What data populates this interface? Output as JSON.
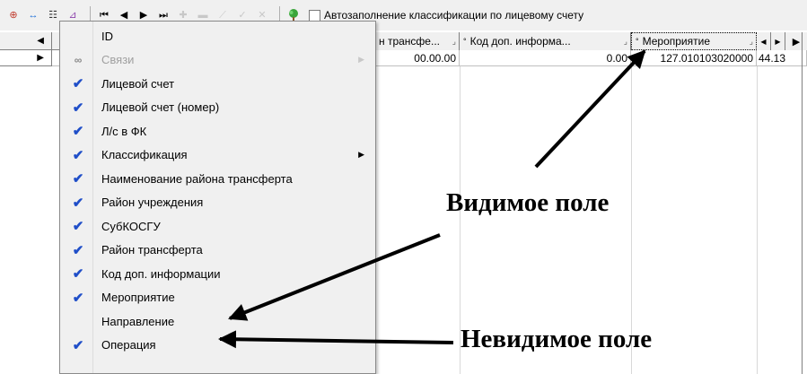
{
  "toolbar": {
    "buttons": [
      {
        "name": "add-record-icon",
        "glyph": "⊕",
        "color": "#c0392b"
      },
      {
        "name": "swap-icon",
        "glyph": "↔",
        "color": "#1e6fd9"
      },
      {
        "name": "list-icon",
        "glyph": "☷",
        "color": "#333"
      },
      {
        "name": "filter-icon",
        "glyph": "⊿",
        "color": "#8e44ad"
      }
    ],
    "nav": [
      {
        "name": "first-record-icon",
        "glyph": "⏮",
        "enabled": true
      },
      {
        "name": "prev-record-icon",
        "glyph": "◀",
        "enabled": true
      },
      {
        "name": "next-record-icon",
        "glyph": "▶",
        "enabled": true
      },
      {
        "name": "last-record-icon",
        "glyph": "⏭",
        "enabled": true
      },
      {
        "name": "insert-record-icon",
        "glyph": "✚",
        "enabled": false
      },
      {
        "name": "delete-record-icon",
        "glyph": "▬",
        "enabled": false
      },
      {
        "name": "edit-record-icon",
        "glyph": "⟋",
        "enabled": false
      },
      {
        "name": "post-record-icon",
        "glyph": "✓",
        "enabled": false
      },
      {
        "name": "cancel-record-icon",
        "glyph": "✕",
        "enabled": false
      }
    ],
    "tree_icon": "tree-icon",
    "autofill_label": "Автозаполнение классификации по лицевому счету"
  },
  "grid": {
    "headers": [
      {
        "label": "н трансфе...",
        "sort": "⌟"
      },
      {
        "label": "Код доп. информа...",
        "sort": "⌟",
        "marker": "°"
      },
      {
        "label": "Мероприятие",
        "sort": "⌟",
        "marker": "°",
        "selected": true
      }
    ],
    "row": [
      "00.00.00",
      "0.00",
      "127.010103020000",
      "44.13"
    ]
  },
  "menu": {
    "items": [
      {
        "label": "ID",
        "checked": false,
        "enabled": true,
        "submenu": false
      },
      {
        "label": "Связи",
        "checked": false,
        "enabled": false,
        "submenu": true,
        "icon": "link-icon"
      },
      {
        "label": "Лицевой счет",
        "checked": true,
        "enabled": true,
        "submenu": false
      },
      {
        "label": "Лицевой счет (номер)",
        "checked": true,
        "enabled": true,
        "submenu": false
      },
      {
        "label": "Л/с в ФК",
        "checked": true,
        "enabled": true,
        "submenu": false
      },
      {
        "label": "Классификация",
        "checked": true,
        "enabled": true,
        "submenu": true
      },
      {
        "label": "Наименование района трансферта",
        "checked": true,
        "enabled": true,
        "submenu": false
      },
      {
        "label": "Район учреждения",
        "checked": true,
        "enabled": true,
        "submenu": false
      },
      {
        "label": "СубКОСГУ",
        "checked": true,
        "enabled": true,
        "submenu": false
      },
      {
        "label": "Район трансферта",
        "checked": true,
        "enabled": true,
        "submenu": false
      },
      {
        "label": "Код доп. информации",
        "checked": true,
        "enabled": true,
        "submenu": false
      },
      {
        "label": "Мероприятие",
        "checked": true,
        "enabled": true,
        "submenu": false
      },
      {
        "label": "Направление",
        "checked": false,
        "enabled": true,
        "submenu": false
      },
      {
        "label": "Операция",
        "checked": true,
        "enabled": true,
        "submenu": false
      }
    ]
  },
  "annotations": {
    "visible": "Видимое поле",
    "invisible": "Невидимое поле"
  }
}
